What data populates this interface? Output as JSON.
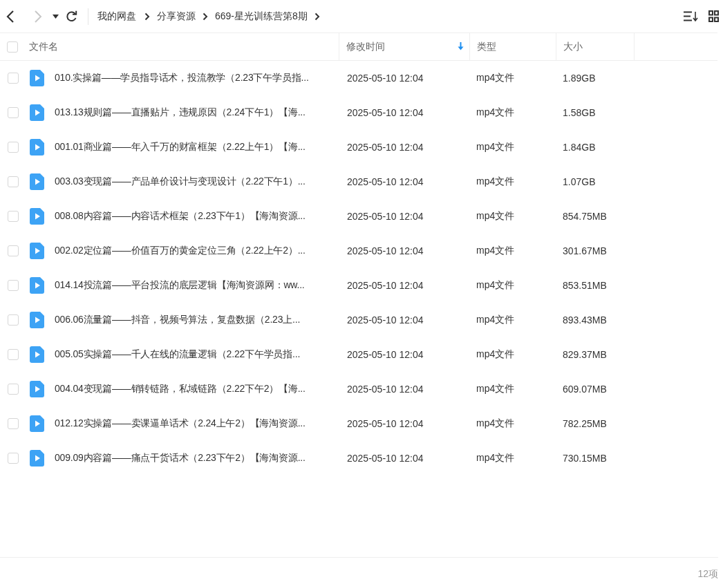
{
  "toolbar": {
    "nav_buttons": [
      {
        "kind": "back",
        "disabled": false
      },
      {
        "kind": "forward",
        "disabled": true
      },
      {
        "kind": "history",
        "disabled": false
      },
      {
        "kind": "refresh",
        "disabled": false
      }
    ],
    "breadcrumb": [
      "我的网盘",
      "分享资源",
      "669-星光训练营第8期"
    ],
    "view_buttons": [
      {
        "kind": "sort"
      },
      {
        "kind": "grid"
      }
    ]
  },
  "table": {
    "select_all": {
      "checked": false
    },
    "columns": [
      {
        "label": "文件名",
        "sorted": false
      },
      {
        "label": "修改时间",
        "sorted": true
      },
      {
        "label": "类型",
        "sorted": false
      },
      {
        "label": "大小",
        "sorted": false
      }
    ],
    "rows": [
      {
        "checked": false,
        "name": "010.实操篇——学员指导话术，投流教学（2.23下午学员指...",
        "modified": "2025-05-10 12:04",
        "type": "mp4文件",
        "size": "1.89GB"
      },
      {
        "checked": false,
        "name": "013.13规则篇——直播贴片，违规原因（2.24下午1）【海...",
        "modified": "2025-05-10 12:04",
        "type": "mp4文件",
        "size": "1.58GB"
      },
      {
        "checked": false,
        "name": "001.01商业篇——年入千万的财富框架（2.22上午1）【海...",
        "modified": "2025-05-10 12:04",
        "type": "mp4文件",
        "size": "1.84GB"
      },
      {
        "checked": false,
        "name": "003.03变现篇——产品单价设计与变现设计（2.22下午1）...",
        "modified": "2025-05-10 12:04",
        "type": "mp4文件",
        "size": "1.07GB"
      },
      {
        "checked": false,
        "name": "008.08内容篇——内容话术框架（2.23下午1）【海淘资源...",
        "modified": "2025-05-10 12:04",
        "type": "mp4文件",
        "size": "854.75MB"
      },
      {
        "checked": false,
        "name": "002.02定位篇——价值百万的黄金定位三角（2.22上午2）...",
        "modified": "2025-05-10 12:04",
        "type": "mp4文件",
        "size": "301.67MB"
      },
      {
        "checked": false,
        "name": "014.14投流篇——平台投流的底层逻辑【海淘资源网：ww...",
        "modified": "2025-05-10 12:04",
        "type": "mp4文件",
        "size": "853.51MB"
      },
      {
        "checked": false,
        "name": "006.06流量篇——抖音，视频号算法，复盘数据（2.23上...",
        "modified": "2025-05-10 12:04",
        "type": "mp4文件",
        "size": "893.43MB"
      },
      {
        "checked": false,
        "name": "005.05实操篇——千人在线的流量逻辑（2.22下午学员指...",
        "modified": "2025-05-10 12:04",
        "type": "mp4文件",
        "size": "829.37MB"
      },
      {
        "checked": false,
        "name": "004.04变现篇——销转链路，私域链路（2.22下午2）【海...",
        "modified": "2025-05-10 12:04",
        "type": "mp4文件",
        "size": "609.07MB"
      },
      {
        "checked": false,
        "name": "012.12实操篇——卖课逼单话术（2.24上午2）【海淘资源...",
        "modified": "2025-05-10 12:04",
        "type": "mp4文件",
        "size": "782.25MB"
      },
      {
        "checked": false,
        "name": "009.09内容篇——痛点干货话术（2.23下午2）【海淘资源...",
        "modified": "2025-05-10 12:04",
        "type": "mp4文件",
        "size": "730.15MB"
      }
    ]
  },
  "status_bar": {
    "count": "12项"
  }
}
